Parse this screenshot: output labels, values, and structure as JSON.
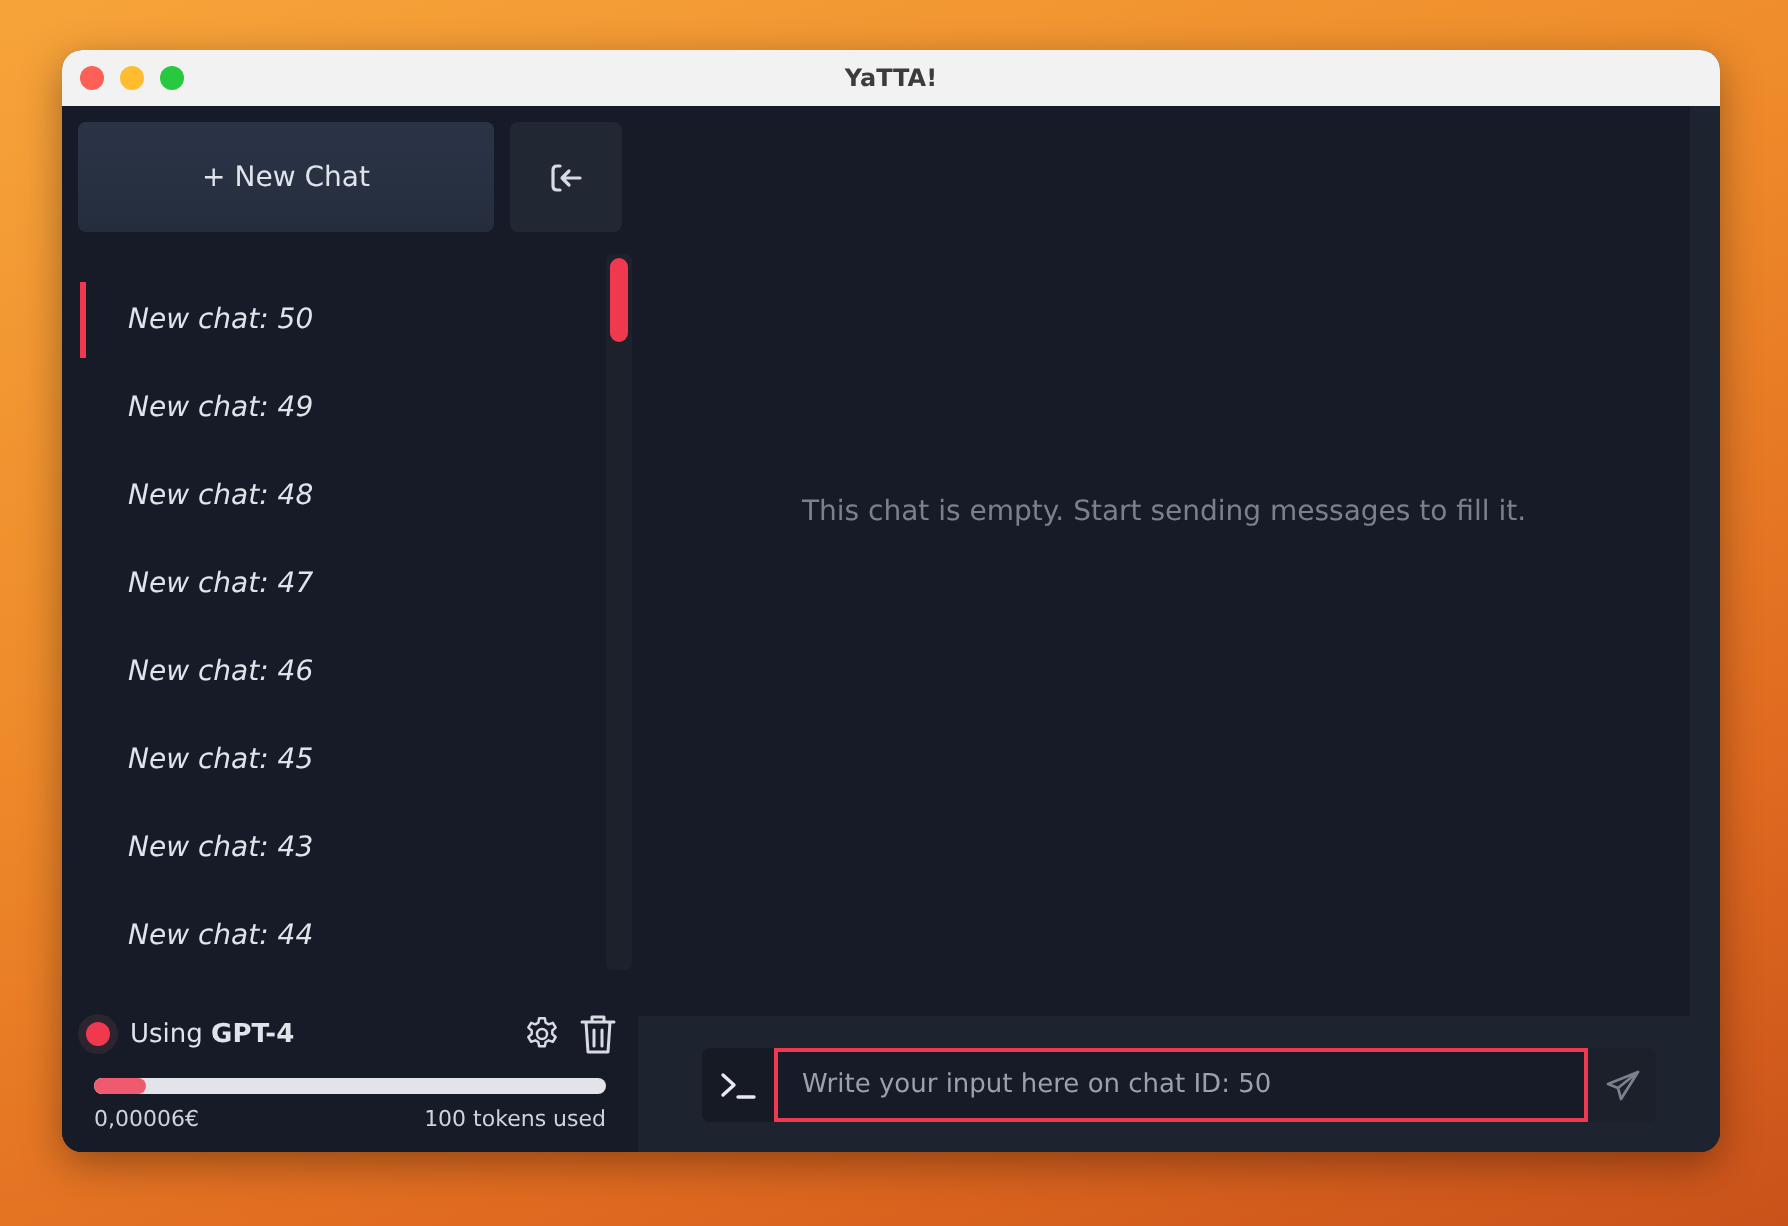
{
  "window": {
    "title": "YaTTA!"
  },
  "sidebar": {
    "new_chat_button": "+ New Chat",
    "chats": [
      {
        "label": "New chat: 50",
        "selected": true
      },
      {
        "label": "New chat: 49",
        "selected": false
      },
      {
        "label": "New chat: 48",
        "selected": false
      },
      {
        "label": "New chat: 47",
        "selected": false
      },
      {
        "label": "New chat: 46",
        "selected": false
      },
      {
        "label": "New chat: 45",
        "selected": false
      },
      {
        "label": "New chat: 43",
        "selected": false
      },
      {
        "label": "New chat: 44",
        "selected": false
      }
    ],
    "model": {
      "label": "Using **GPT-4**",
      "color": "#f0384f"
    },
    "usage": {
      "level": 0.1,
      "cost": "0,00006€",
      "tokens": "100 tokens used"
    }
  },
  "chat": {
    "empty_message": "This chat is empty. Start sending messages to fill it.",
    "input": {
      "placeholder": "Write your input here on chat ID: 50"
    }
  }
}
